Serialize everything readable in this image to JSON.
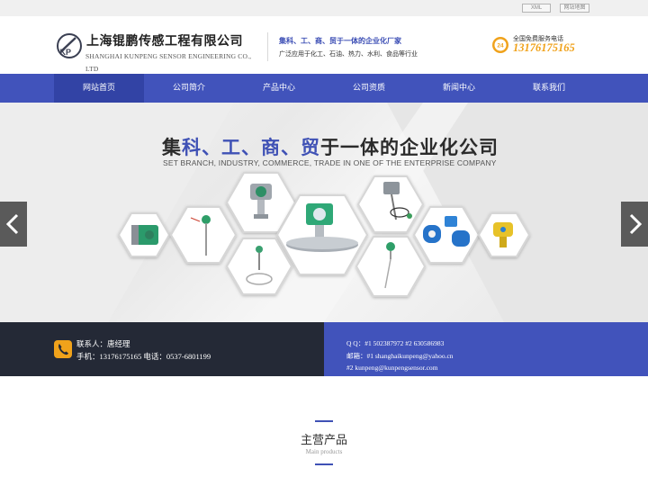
{
  "topbar": {
    "xml_label": "XML",
    "sitemap_label": "网站地图"
  },
  "header": {
    "logo_text": "KP",
    "company_cn": "上海锟鹏传感工程有限公司",
    "company_en": "SHANGHAI KUNPENG SENSOR ENGINEERING CO., LTD",
    "slogan_main": "集科、工、商、贸于一体的企业化厂家",
    "slogan_sub": "广泛应用于化工、石油、热力、水利、食品等行业",
    "hotline_label": "全国免费服务电话",
    "hotline_number": "13176175165",
    "hotline_icon": "phone-24h-icon"
  },
  "nav": {
    "items": [
      {
        "label": "网站首页",
        "active": true
      },
      {
        "label": "公司简介",
        "active": false
      },
      {
        "label": "产品中心",
        "active": false
      },
      {
        "label": "公司资质",
        "active": false
      },
      {
        "label": "新闻中心",
        "active": false
      },
      {
        "label": "联系我们",
        "active": false
      }
    ]
  },
  "banner": {
    "title_part1": "集",
    "title_accent": "科、工、商、贸",
    "title_part2": "于一体的企业化公司",
    "subtitle": "SET BRANCH, INDUSTRY, COMMERCE, TRADE IN ONE OF THE ENTERPRISE COMPANY",
    "prev_icon": "chevron-left-icon",
    "next_icon": "chevron-right-icon"
  },
  "contact": {
    "name": "联系人：唐经理",
    "phone": "手机：13176175165 电话：0537-6801199",
    "qq": "Q Q：#1 502387972 #2 630586983",
    "email1": "邮箱：#1 shanghaikunpeng@yahoo.cn",
    "email2": "#2 kunpeng@kunpengsensor.com"
  },
  "section": {
    "title": "主营产品",
    "subtitle": "Main products"
  },
  "colors": {
    "brand_blue": "#4153bb",
    "nav_active": "#3243a5",
    "hotline_orange": "#f0a21b",
    "dark_band": "#242936"
  }
}
